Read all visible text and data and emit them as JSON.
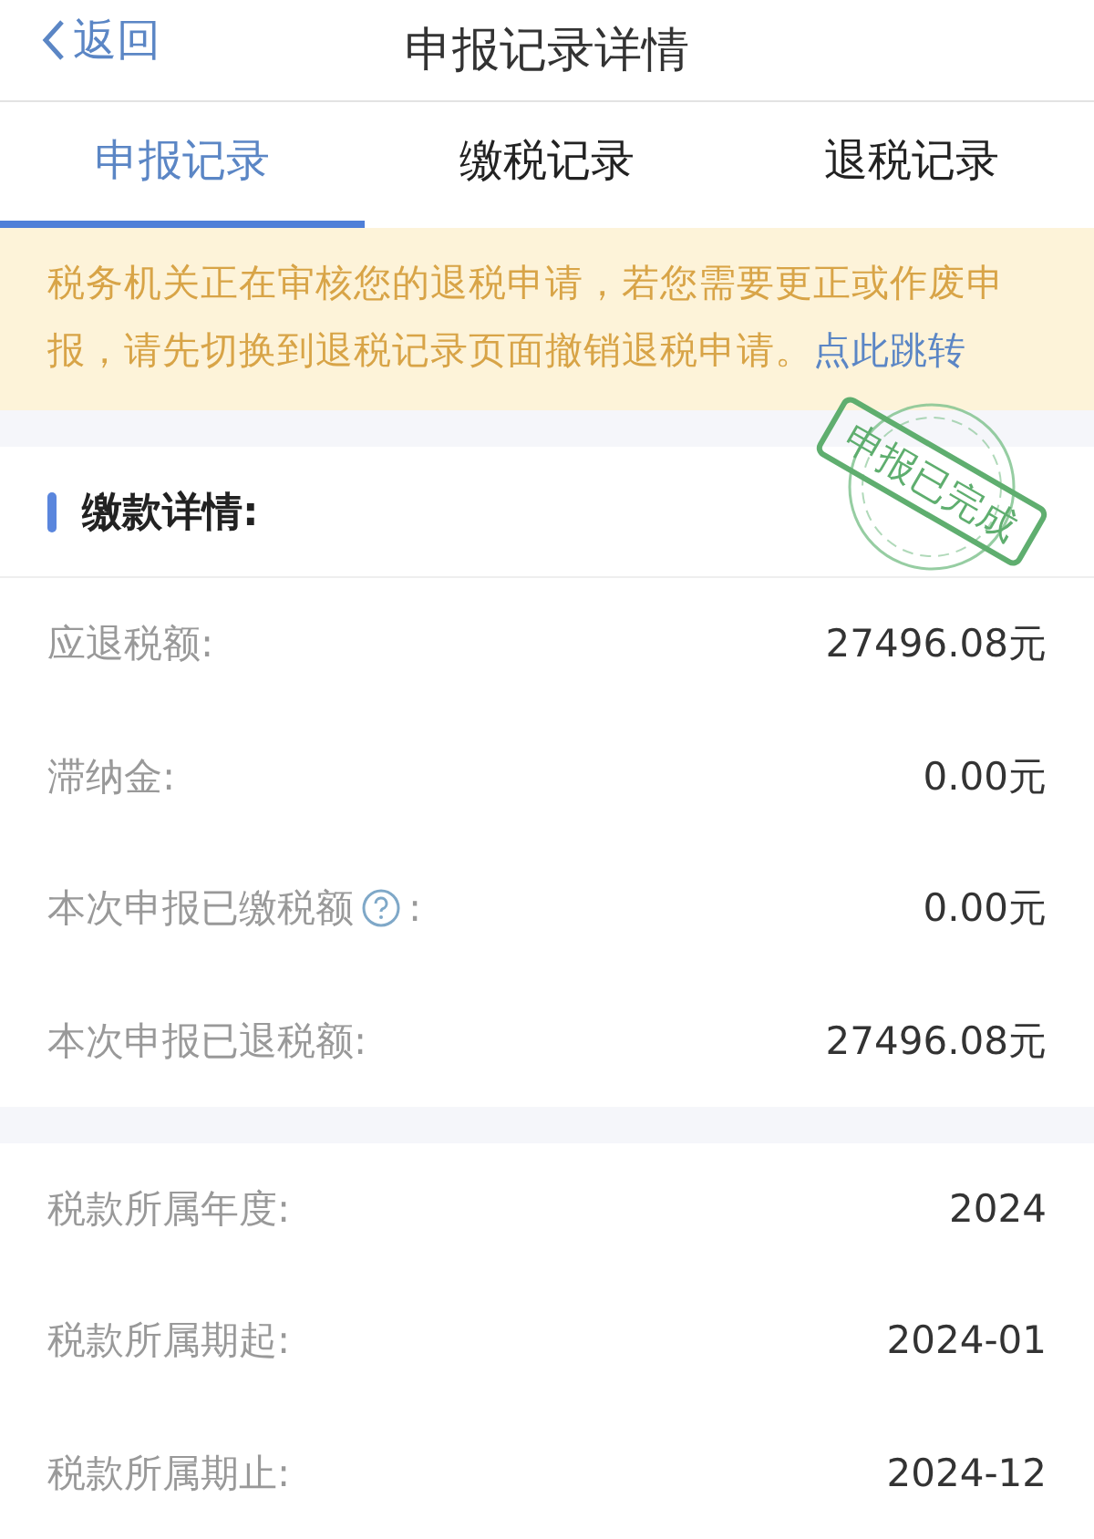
{
  "nav": {
    "back": "返回",
    "title": "申报记录详情"
  },
  "tabs": [
    {
      "label": "申报记录",
      "selected": true
    },
    {
      "label": "缴税记录",
      "selected": false
    },
    {
      "label": "退税记录",
      "selected": false
    }
  ],
  "notice": {
    "text": "税务机关正在审核您的退税申请，若您需要更正或作废申报，请先切换到退税记录页面撤销退税申请。",
    "link": "点此跳转"
  },
  "stamp": {
    "text": "申报已完成"
  },
  "section": {
    "title": "缴款详情:"
  },
  "payment_rows": [
    {
      "label": "应退税额:",
      "value": "27496.08元",
      "help": false
    },
    {
      "label": "滞纳金:",
      "value": "0.00元",
      "help": false
    },
    {
      "label": "本次申报已缴税额",
      "suffix": ":",
      "value": "0.00元",
      "help": true
    },
    {
      "label": "本次申报已退税额:",
      "value": "27496.08元",
      "help": false
    }
  ],
  "period_rows": [
    {
      "label": "税款所属年度:",
      "value": "2024"
    },
    {
      "label": "税款所属期起:",
      "value": "2024-01"
    },
    {
      "label": "税款所属期止:",
      "value": "2024-12"
    }
  ]
}
